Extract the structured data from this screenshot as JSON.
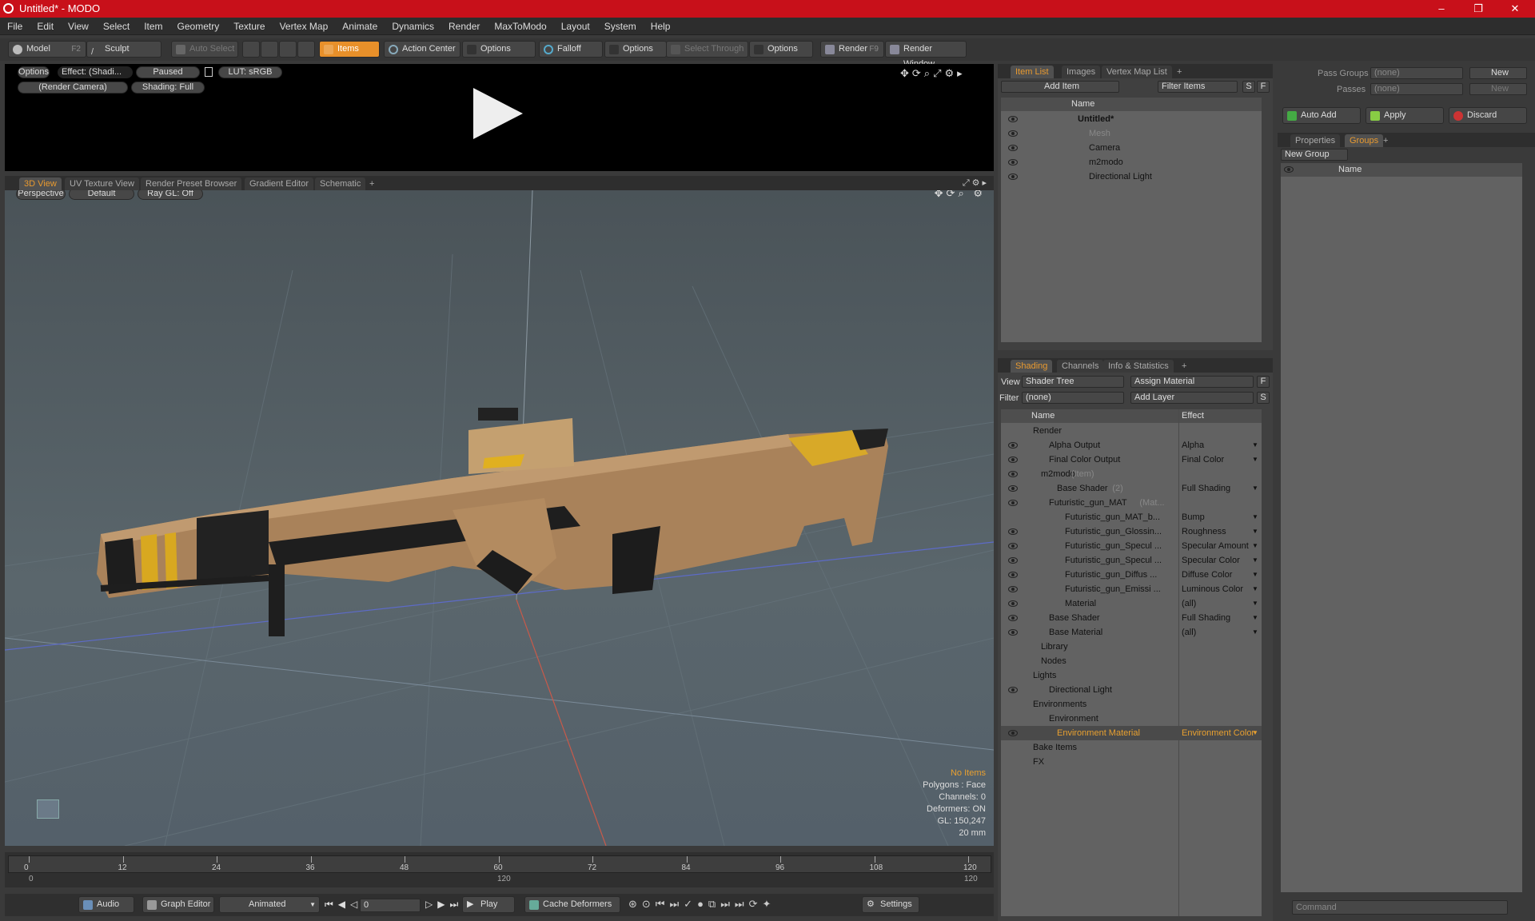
{
  "window": {
    "title": "Untitled* - MODO",
    "min": "–",
    "max": "❐",
    "close": "✕"
  },
  "menu": [
    "File",
    "Edit",
    "View",
    "Select",
    "Item",
    "Geometry",
    "Texture",
    "Vertex Map",
    "Animate",
    "Dynamics",
    "Render",
    "MaxToModo",
    "Layout",
    "System",
    "Help"
  ],
  "toolbar": {
    "model": "Model",
    "model_key": "F2",
    "sculpt": "Sculpt",
    "auto_select": "Auto Select",
    "items": "Items",
    "action_center": "Action Center",
    "options1": "Options",
    "falloff": "Falloff",
    "options2": "Options",
    "select_through": "Select Through",
    "options3": "Options",
    "render": "Render",
    "render_key": "F9",
    "render_window": "Render Window"
  },
  "render_preview": {
    "options": "Options",
    "effect": "Effect: (Shadi...",
    "paused": "Paused",
    "lut": "LUT: sRGB",
    "camera": "(Render Camera)",
    "shading": "Shading: Full"
  },
  "viewport": {
    "tabs": [
      "3D View",
      "UV Texture View",
      "Render Preset Browser",
      "Gradient Editor",
      "Schematic",
      "+"
    ],
    "perspective": "Perspective",
    "default": "Default",
    "raygl": "Ray GL: Off",
    "hud": {
      "no_items": "No Items",
      "polygons": "Polygons : Face",
      "channels": "Channels: 0",
      "deformers": "Deformers: ON",
      "gl": "GL: 150,247",
      "scale": "20 mm"
    },
    "accent": "#e8a030"
  },
  "timeline": {
    "ticks": [
      "0",
      "12",
      "24",
      "36",
      "48",
      "60",
      "72",
      "84",
      "96",
      "108",
      "120"
    ],
    "sub_left": "0",
    "sub_mid": "120",
    "sub_right": "120"
  },
  "bottombar": {
    "audio": "Audio",
    "graph_editor": "Graph Editor",
    "animated": "Animated",
    "frame": "0",
    "play": "Play",
    "cache": "Cache Deformers",
    "settings": "Settings"
  },
  "item_list": {
    "tabs": [
      "Item List",
      "Images",
      "Vertex Map List",
      "+"
    ],
    "add_item": "Add Item",
    "filter": "Filter Items",
    "s": "S",
    "f": "F",
    "name_header": "Name",
    "items": [
      {
        "label": "Untitled*",
        "bold": true,
        "indent": 0
      },
      {
        "label": "Mesh",
        "dim": true,
        "indent": 1
      },
      {
        "label": "Camera",
        "indent": 1
      },
      {
        "label": "m2modo",
        "indent": 1
      },
      {
        "label": "Directional Light",
        "indent": 1
      }
    ]
  },
  "shading": {
    "tabs": [
      "Shading",
      "Channels",
      "Info & Statistics",
      "+"
    ],
    "view_label": "View",
    "view_value": "Shader Tree",
    "assign": "Assign Material",
    "f": "F",
    "filter_label": "Filter",
    "filter_value": "(none)",
    "add_layer": "Add Layer",
    "s": "S",
    "col_name": "Name",
    "col_effect": "Effect",
    "rows": [
      {
        "name": "Render",
        "effect": "",
        "indent": 0,
        "eye": false
      },
      {
        "name": "Alpha Output",
        "effect": "Alpha",
        "indent": 2,
        "eye": true
      },
      {
        "name": "Final Color Output",
        "effect": "Final Color",
        "indent": 2,
        "eye": true
      },
      {
        "name": "m2modo",
        "suffix": " (Item)",
        "effect": "",
        "indent": 1,
        "eye": true
      },
      {
        "name": "Base Shader",
        "suffix": " (2)",
        "effect": "Full Shading",
        "indent": 3,
        "eye": true
      },
      {
        "name": "Futuristic_gun_MAT",
        "suffix": " (Mat...",
        "effect": "",
        "indent": 2,
        "eye": true
      },
      {
        "name": "Futuristic_gun_MAT_b...",
        "effect": "Bump",
        "indent": 4,
        "eye": false
      },
      {
        "name": "Futuristic_gun_Glossin...",
        "effect": "Roughness",
        "indent": 4,
        "eye": true
      },
      {
        "name": "Futuristic_gun_Specul ...",
        "effect": "Specular Amount",
        "indent": 4,
        "eye": true
      },
      {
        "name": "Futuristic_gun_Specul ...",
        "effect": "Specular Color",
        "indent": 4,
        "eye": true
      },
      {
        "name": "Futuristic_gun_Diffus ...",
        "effect": "Diffuse Color",
        "indent": 4,
        "eye": true
      },
      {
        "name": "Futuristic_gun_Emissi ...",
        "effect": "Luminous Color",
        "indent": 4,
        "eye": true
      },
      {
        "name": "Material",
        "effect": "(all)",
        "indent": 4,
        "eye": true
      },
      {
        "name": "Base Shader",
        "effect": "Full Shading",
        "indent": 2,
        "eye": true
      },
      {
        "name": "Base Material",
        "effect": "(all)",
        "indent": 2,
        "eye": true
      },
      {
        "name": "Library",
        "effect": "",
        "indent": 1,
        "eye": false
      },
      {
        "name": "Nodes",
        "effect": "",
        "indent": 1,
        "eye": false
      },
      {
        "name": "Lights",
        "effect": "",
        "indent": 0,
        "eye": false
      },
      {
        "name": "Directional Light",
        "effect": "",
        "indent": 2,
        "eye": true
      },
      {
        "name": "Environments",
        "effect": "",
        "indent": 0,
        "eye": false
      },
      {
        "name": "Environment",
        "effect": "",
        "indent": 2,
        "eye": false
      },
      {
        "name": "Environment Material",
        "effect": "Environment Color",
        "indent": 3,
        "eye": true,
        "selected": true
      },
      {
        "name": "Bake Items",
        "effect": "",
        "indent": 0,
        "eye": false
      },
      {
        "name": "FX",
        "effect": "",
        "indent": 0,
        "eye": false
      }
    ]
  },
  "groups": {
    "pass_groups": "Pass Groups",
    "pass_groups_val": "(none)",
    "new": "New",
    "passes": "Passes",
    "passes_val": "(none)",
    "new2": "New",
    "auto_add": "Auto Add",
    "apply": "Apply",
    "discard": "Discard",
    "tabs": [
      "Properties",
      "Groups",
      "+"
    ],
    "new_group": "New Group",
    "name_header": "Name"
  },
  "command": {
    "placeholder": "Command"
  }
}
